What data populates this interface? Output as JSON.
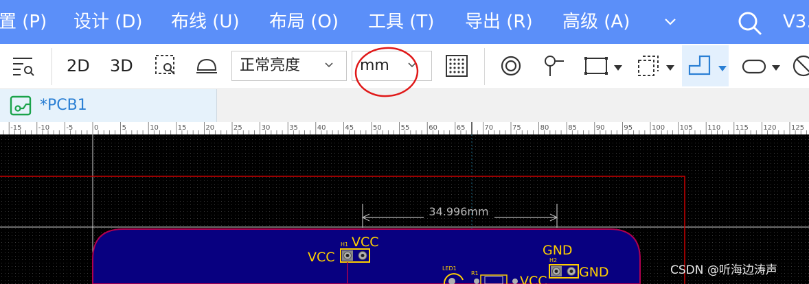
{
  "menubar": {
    "items": [
      {
        "label": "置 (P)"
      },
      {
        "label": "设计 (D)"
      },
      {
        "label": "布线 (U)"
      },
      {
        "label": "布局 (O)"
      },
      {
        "label": "工具 (T)"
      },
      {
        "label": "导出 (R)"
      },
      {
        "label": "高级 (A)"
      }
    ],
    "version": "V3.",
    "icons": {
      "more": "chevron-down-icon",
      "search": "search-icon"
    }
  },
  "toolbar": {
    "view_2d": "2D",
    "view_3d": "3D",
    "brightness": {
      "selected": "正常亮度"
    },
    "units": {
      "selected": "mm"
    }
  },
  "tab": {
    "label": "*PCB1"
  },
  "ruler": {
    "labels": [
      "-15",
      "-10",
      "-5",
      "0",
      "5",
      "10",
      "15",
      "20",
      "25",
      "30",
      "35",
      "40",
      "45",
      "50",
      "55",
      "60",
      "65",
      "70",
      "75",
      "80",
      "85",
      "90",
      "95",
      "100",
      "105",
      "110",
      "115",
      "120",
      "125"
    ]
  },
  "canvas": {
    "dimension": "34.996mm",
    "components": [
      {
        "ref": "H1",
        "net_top": "VCC",
        "net_left": "VCC"
      },
      {
        "ref": "H2",
        "net_top": "GND",
        "net_right": "GND"
      },
      {
        "ref": "LED1"
      },
      {
        "ref": "R1",
        "net": "VCC"
      }
    ],
    "colors": {
      "board": "#080080",
      "outline": "#b0004e",
      "silkscreen": "#ffd000",
      "keepout": "#cc0000"
    }
  },
  "watermark": "CSDN @听海边涛声"
}
